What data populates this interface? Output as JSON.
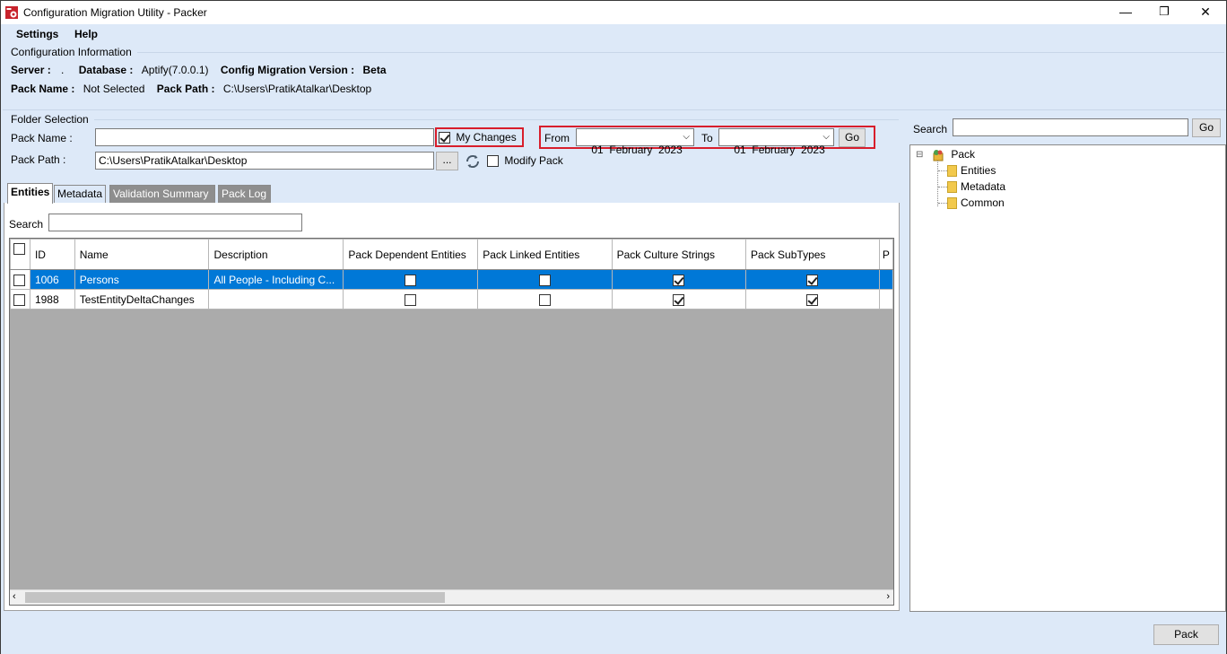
{
  "window": {
    "title": "Configuration Migration Utility - Packer",
    "minimize": "—",
    "restore": "❐",
    "close": "✕"
  },
  "menu": {
    "settings": "Settings",
    "help": "Help"
  },
  "config_info": {
    "header": "Configuration Information",
    "server_label": "Server :",
    "server_value": ".",
    "database_label": "Database :",
    "database_value": "Aptify(7.0.0.1)",
    "version_label": "Config Migration Version :",
    "version_value": "Beta",
    "pack_name_label": "Pack Name :",
    "pack_name_value": "Not Selected",
    "pack_path_label": "Pack Path :",
    "pack_path_value": "C:\\Users\\PratikAtalkar\\Desktop"
  },
  "folder_selection": {
    "header": "Folder Selection",
    "pack_name_label": "Pack Name :",
    "pack_name_value": "",
    "pack_path_label": "Pack Path :",
    "pack_path_value": "C:\\Users\\PratikAtalkar\\Desktop",
    "browse_label": "...",
    "my_changes_label": "My Changes",
    "my_changes_checked": true,
    "modify_pack_label": "Modify Pack",
    "modify_pack_checked": false,
    "from_label": "From",
    "from_date": "01  February  2023",
    "to_label": "To",
    "to_date": "01  February  2023",
    "go_label": "Go"
  },
  "tabs": [
    {
      "label": "Entities",
      "active": true
    },
    {
      "label": "Metadata",
      "active": false
    },
    {
      "label": "Validation Summary",
      "active": false
    },
    {
      "label": "Pack Log",
      "active": false
    }
  ],
  "entities": {
    "search_label": "Search",
    "search_value": "",
    "columns": [
      "ID",
      "Name",
      "Description",
      "Pack Dependent Entities",
      "Pack Linked Entities",
      "Pack Culture Strings",
      "Pack SubTypes",
      "P"
    ],
    "rows": [
      {
        "selected": true,
        "id": "1006",
        "name": "Persons",
        "description": "All People - Including C...",
        "dependent": false,
        "linked": false,
        "culture": true,
        "subtypes": true
      },
      {
        "selected": false,
        "id": "1988",
        "name": "TestEntityDeltaChanges",
        "description": "",
        "dependent": false,
        "linked": false,
        "culture": true,
        "subtypes": true
      }
    ]
  },
  "right_panel": {
    "search_label": "Search",
    "search_value": "",
    "go_label": "Go",
    "tree_root": "Pack",
    "tree_children": [
      "Entities",
      "Metadata",
      "Common"
    ],
    "expander": "⊟"
  },
  "footer": {
    "pack_button": "Pack"
  },
  "colors": {
    "accent": "#0078d7",
    "highlight_border": "#d81e2c",
    "background": "#dde9f8"
  }
}
